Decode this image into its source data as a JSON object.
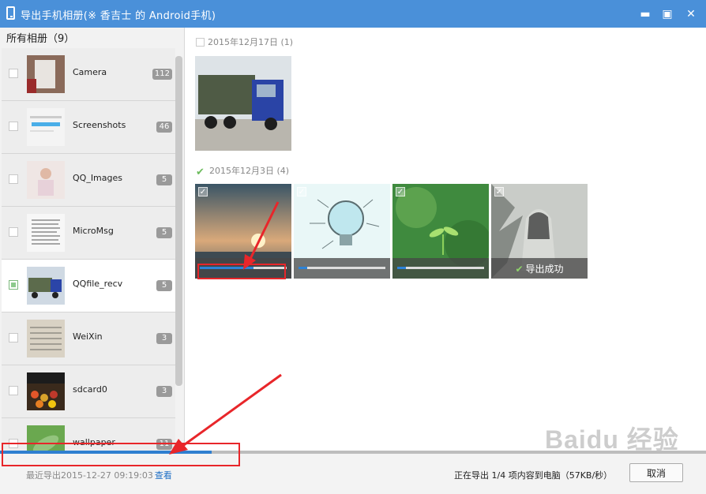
{
  "window": {
    "title": "导出手机相册(※ 香吉士 的 Android手机)",
    "min_glyph": "▬",
    "max_glyph": "▣",
    "close_glyph": "✕"
  },
  "sidebar": {
    "header": "所有相册（9）",
    "albums": [
      {
        "name": "Camera",
        "count": "112",
        "selected": false
      },
      {
        "name": "Screenshots",
        "count": "46",
        "selected": false
      },
      {
        "name": "QQ_Images",
        "count": "5",
        "selected": false
      },
      {
        "name": "MicroMsg",
        "count": "5",
        "selected": false
      },
      {
        "name": "QQfile_recv",
        "count": "5",
        "selected": true
      },
      {
        "name": "WeiXin",
        "count": "3",
        "selected": false
      },
      {
        "name": "sdcard0",
        "count": "3",
        "selected": false
      },
      {
        "name": "wallpaper",
        "count": "11",
        "selected": false
      }
    ]
  },
  "main": {
    "groups": [
      {
        "date": "2015年12月17日 (1)",
        "checked": false
      },
      {
        "date": "2015年12月3日 (4)",
        "checked": true
      }
    ],
    "photos": [
      {
        "subject": "truck",
        "progress": 0.62
      },
      {
        "subject": "lightbulb",
        "progress": 0.1
      },
      {
        "subject": "sprout",
        "progress": 0.1
      },
      {
        "subject": "portrait",
        "status_text": "导出成功"
      }
    ]
  },
  "footer": {
    "last_export": "最近导出2015-12-27 09:19:03",
    "view_link": "查看",
    "status": "正在导出 1/4 项内容到电脑（57KB/秒）",
    "cancel_label": "取消",
    "overall_progress": 0.3
  },
  "watermark": "Baidu 经验",
  "colors": {
    "titlebar": "#4a90d9",
    "progress": "#2f7fd0",
    "annotation": "#e8262a"
  }
}
